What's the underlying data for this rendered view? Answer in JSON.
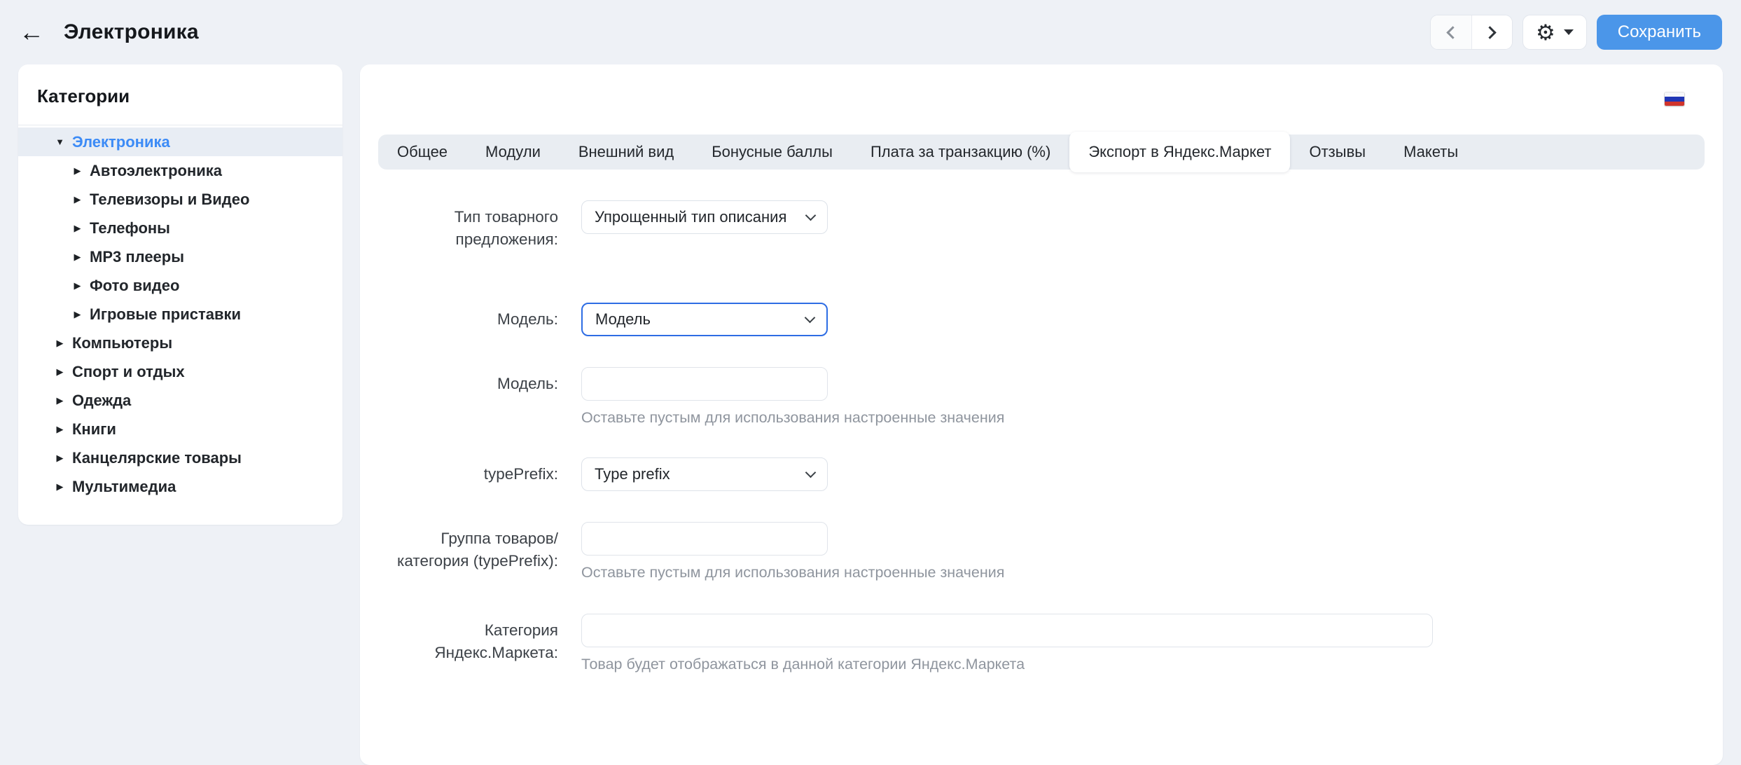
{
  "header": {
    "title": "Электроника",
    "save_label": "Сохранить"
  },
  "icons": {
    "back_arrow": "←",
    "gear": "⚙",
    "caret_down": "▼",
    "caret_right": "▶"
  },
  "sidebar": {
    "title": "Категории",
    "items": [
      {
        "label": "Электроника",
        "level": 0,
        "expanded": true,
        "selected": true
      },
      {
        "label": "Автоэлектроника",
        "level": 1,
        "expanded": false,
        "selected": false
      },
      {
        "label": "Телевизоры и Видео",
        "level": 1,
        "expanded": false,
        "selected": false
      },
      {
        "label": "Телефоны",
        "level": 1,
        "expanded": false,
        "selected": false
      },
      {
        "label": "MP3 плееры",
        "level": 1,
        "expanded": false,
        "selected": false
      },
      {
        "label": "Фото видео",
        "level": 1,
        "expanded": false,
        "selected": false
      },
      {
        "label": "Игровые приставки",
        "level": 1,
        "expanded": false,
        "selected": false
      },
      {
        "label": "Компьютеры",
        "level": 0,
        "expanded": false,
        "selected": false
      },
      {
        "label": "Спорт и отдых",
        "level": 0,
        "expanded": false,
        "selected": false
      },
      {
        "label": "Одежда",
        "level": 0,
        "expanded": false,
        "selected": false
      },
      {
        "label": "Книги",
        "level": 0,
        "expanded": false,
        "selected": false
      },
      {
        "label": "Канцелярские товары",
        "level": 0,
        "expanded": false,
        "selected": false
      },
      {
        "label": "Мультимедиа",
        "level": 0,
        "expanded": false,
        "selected": false
      }
    ]
  },
  "main": {
    "flag": "russian-flag",
    "tabs": [
      {
        "label": "Общее",
        "active": false
      },
      {
        "label": "Модули",
        "active": false
      },
      {
        "label": "Внешний вид",
        "active": false
      },
      {
        "label": "Бонусные баллы",
        "active": false
      },
      {
        "label": "Плата за транзакцию (%)",
        "active": false
      },
      {
        "label": "Экспорт в Яндекс.Маркет",
        "active": true
      },
      {
        "label": "Отзывы",
        "active": false
      },
      {
        "label": "Макеты",
        "active": false
      }
    ],
    "form": {
      "rows": [
        {
          "label": "Тип товарного предложения:",
          "type": "select",
          "value": "Упрощенный тип описания",
          "focused": false
        },
        {
          "label": "Модель:",
          "type": "select",
          "value": "Модель",
          "focused": true
        },
        {
          "label": "Модель:",
          "type": "input",
          "value": "",
          "hint": "Оставьте пустым для использования настроенные значения"
        },
        {
          "label": "typePrefix:",
          "type": "select",
          "value": "Type prefix",
          "focused": false
        },
        {
          "label": "Группа товаров/категория (typePrefix):",
          "type": "input",
          "value": "",
          "hint": "Оставьте пустым для использования настроенные значения"
        },
        {
          "label": "Категория Яндекс.Маркета:",
          "type": "input",
          "value": "",
          "hint": "Товар будет отображаться в данной категории Яндекс.Маркета",
          "wide": true
        }
      ]
    }
  },
  "colors": {
    "page_bg": "#eef1f6",
    "card_bg": "#ffffff",
    "accent_blue": "#4b96e9",
    "focus_border": "#2e6de4",
    "selected_item_text": "#3c8bf6",
    "selected_item_bg": "#e8edf4",
    "tab_bar_bg": "#e9edf2",
    "hint_text": "#8f959e",
    "flag_blue": "#2036b5",
    "flag_red": "#d0342c"
  }
}
